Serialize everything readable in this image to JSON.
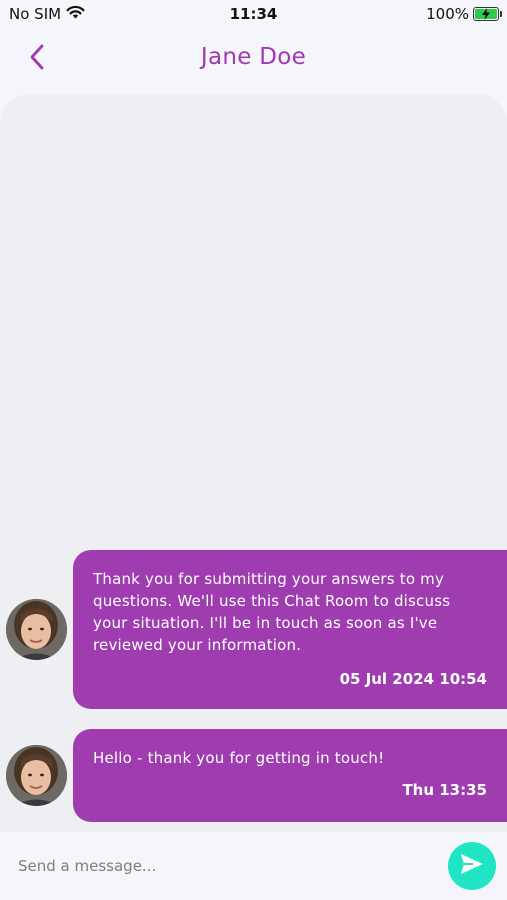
{
  "status_bar": {
    "carrier": "No SIM",
    "time": "11:34",
    "battery": "100%"
  },
  "header": {
    "title": "Jane Doe",
    "back_icon": "chevron-left-icon"
  },
  "messages": [
    {
      "text": "Thank you for submitting your answers to my questions. We'll use this Chat Room to discuss your situation. I'll be in touch as soon as I've reviewed your information.",
      "time": "05 Jul 2024 10:54"
    },
    {
      "text": "Hello - thank you for getting in touch!",
      "time": "Thu 13:35"
    }
  ],
  "composer": {
    "placeholder": "Send a message...",
    "send_icon": "send-icon"
  },
  "colors": {
    "accent": "#a03ab0",
    "bubble": "#9e3cb0",
    "send": "#21e4c4",
    "battery": "#2ecc4a"
  }
}
